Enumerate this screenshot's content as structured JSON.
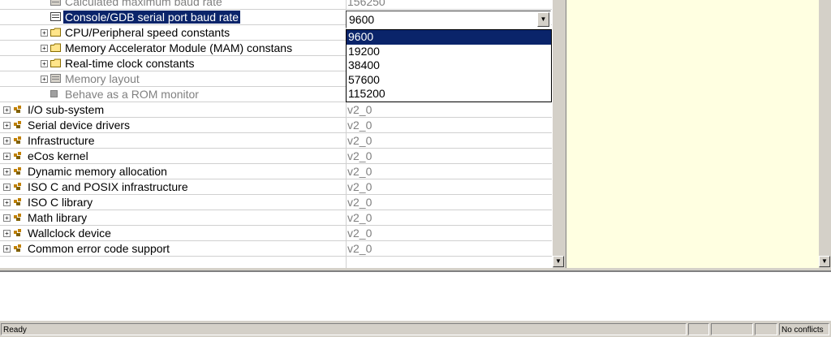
{
  "tree": {
    "partial_row": {
      "label": "Calculated maximum baud rate",
      "value": "156250"
    },
    "selected_row": {
      "label": "Console/GDB serial port baud rate"
    },
    "sub_rows": [
      {
        "label": "CPU/Peripheral speed constants",
        "gray": false
      },
      {
        "label": "Memory Accelerator Module (MAM) constans",
        "gray": false
      },
      {
        "label": "Real-time clock constants",
        "gray": false
      },
      {
        "label": "Memory layout",
        "gray": true
      },
      {
        "label": "Behave as a ROM monitor",
        "gray": true
      }
    ],
    "packages": [
      {
        "label": "I/O sub-system",
        "version": "v2_0"
      },
      {
        "label": "Serial device drivers",
        "version": "v2_0"
      },
      {
        "label": "Infrastructure",
        "version": "v2_0"
      },
      {
        "label": "eCos kernel",
        "version": "v2_0"
      },
      {
        "label": "Dynamic memory allocation",
        "version": "v2_0"
      },
      {
        "label": "ISO C and POSIX infrastructure",
        "version": "v2_0"
      },
      {
        "label": "ISO C library",
        "version": "v2_0"
      },
      {
        "label": "Math library",
        "version": "v2_0"
      },
      {
        "label": "Wallclock device",
        "version": "v2_0"
      },
      {
        "label": "Common error code support",
        "version": "v2_0"
      }
    ]
  },
  "combo": {
    "value": "9600",
    "options": [
      "9600",
      "19200",
      "38400",
      "57600",
      "115200"
    ],
    "highlighted": "9600"
  },
  "status": {
    "left": "Ready",
    "right": "No conflicts"
  },
  "icons": {
    "folder": "folder-icon",
    "package": "package-icon",
    "option": "option-icon",
    "expand": "expand-icon",
    "scroll": "scroll-arrow-icon"
  },
  "colors": {
    "selection": "#0a246a",
    "panel": "#d4d0c8",
    "info_pane": "#ffffe1"
  }
}
